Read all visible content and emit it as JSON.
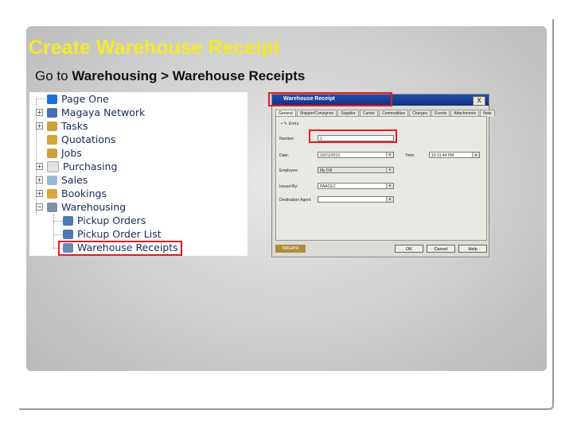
{
  "slide": {
    "title": "Create Warehouse Receipt",
    "subtitle_prefix": "Go to ",
    "subtitle_path": "Warehousing > Warehouse Receipts"
  },
  "tree": {
    "items": [
      {
        "label": "Page One",
        "icon": "page-one-icon",
        "color": "#1d6fd6"
      },
      {
        "label": "Magaya Network",
        "icon": "network-icon",
        "color": "#4a6fb0"
      },
      {
        "label": "Tasks",
        "icon": "tasks-icon",
        "color": "#c8a23a"
      },
      {
        "label": "Quotations",
        "icon": "quotations-icon",
        "color": "#d2a43a"
      },
      {
        "label": "Jobs",
        "icon": "jobs-icon",
        "color": "#caa03c"
      },
      {
        "label": "Purchasing",
        "icon": "purchasing-icon",
        "color": "#e1e1e1"
      },
      {
        "label": "Sales",
        "icon": "sales-icon",
        "color": "#9ab9d6"
      },
      {
        "label": "Bookings",
        "icon": "bookings-icon",
        "color": "#d8a63a"
      },
      {
        "label": "Warehousing",
        "icon": "warehousing-icon",
        "color": "#7f8fa6"
      },
      {
        "label": "Pickup Orders",
        "icon": "pickup-orders-icon",
        "color": "#4e79b8"
      },
      {
        "label": "Pickup Order List",
        "icon": "pickup-order-list-icon",
        "color": "#4e79b8"
      },
      {
        "label": "Warehouse Receipts",
        "icon": "warehouse-receipts-icon",
        "color": "#6e88b4"
      }
    ]
  },
  "dialog": {
    "title": "Warehouse Receipt",
    "close": "X",
    "tabs": [
      "General",
      "Shipper/Consignee",
      "Supplier",
      "Carrier",
      "Commodities",
      "Charges",
      "Events",
      "Attachments",
      "Note"
    ],
    "toolbar": "Entry",
    "fields": {
      "number_label": "Number:",
      "number_value": "1",
      "date_label": "Date:",
      "date_value": "10/21/2013",
      "time_label": "Time:",
      "time_value": "10:31:44 PM",
      "employee_label": "Employee:",
      "employee_value": "My Dill",
      "issued_by_label": "Issued By:",
      "issued_by_value": "PAACEC",
      "destination_label": "Destination Agent:",
      "destination_value": ""
    },
    "status": "MAGAYA",
    "buttons": {
      "ok": "OK",
      "cancel": "Cancel",
      "help": "Help"
    }
  }
}
